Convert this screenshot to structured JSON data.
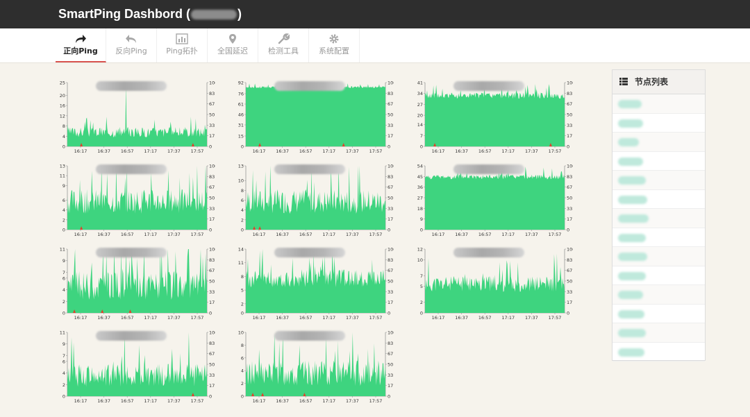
{
  "header": {
    "title_prefix": "SmartPing Dashbord (",
    "title_suffix": ")"
  },
  "nav": {
    "tabs": [
      {
        "label": "正向Ping",
        "icon": "forward-arrow-icon",
        "active": true
      },
      {
        "label": "反向Ping",
        "icon": "reply-arrow-icon",
        "active": false
      },
      {
        "label": "Ping拓扑",
        "icon": "bar-chart-icon",
        "active": false
      },
      {
        "label": "全国延迟",
        "icon": "map-marker-icon",
        "active": false
      },
      {
        "label": "检测工具",
        "icon": "wrench-icon",
        "active": false
      },
      {
        "label": "系统配置",
        "icon": "gear-icon",
        "active": false
      }
    ]
  },
  "sidebar": {
    "title": "节点列表",
    "icon": "list-icon",
    "node_count": 14
  },
  "colors": {
    "fill": "#3ed47f",
    "loss": "#e0412b",
    "header_bg": "#2e2e2e"
  },
  "chart_data": [
    {
      "type": "area",
      "x_ticks": [
        "16:17",
        "16:37",
        "16:57",
        "17:17",
        "17:37",
        "17:57"
      ],
      "y_left": [
        0,
        4,
        8,
        12,
        16,
        20,
        25
      ],
      "y_right": [
        0,
        17,
        33,
        50,
        67,
        83,
        100
      ],
      "latency_level": 5,
      "latency_var": 2,
      "spikes": [
        {
          "at": 0.42,
          "value": 24
        }
      ],
      "loss_markers": [
        0.1,
        0.9
      ]
    },
    {
      "type": "area",
      "x_ticks": [
        "16:17",
        "16:37",
        "16:57",
        "17:17",
        "17:37",
        "17:57"
      ],
      "y_left": [
        0,
        15,
        31,
        46,
        61,
        76,
        92
      ],
      "y_right": [
        0,
        17,
        33,
        50,
        67,
        83,
        100
      ],
      "latency_level": 85,
      "latency_var": 1.5,
      "spikes": [],
      "loss_markers": [
        0.1,
        0.7
      ]
    },
    {
      "type": "area",
      "x_ticks": [
        "16:17",
        "16:37",
        "16:57",
        "17:17",
        "17:37",
        "17:57"
      ],
      "y_left": [
        0,
        7,
        14,
        20,
        27,
        34,
        41
      ],
      "y_right": [
        0,
        17,
        33,
        50,
        67,
        83,
        100
      ],
      "latency_level": 32,
      "latency_var": 2,
      "spikes": [],
      "loss_markers": [
        0.07,
        0.9
      ]
    },
    {
      "type": "area",
      "x_ticks": [
        "16:17",
        "16:37",
        "16:57",
        "17:17",
        "17:37",
        "17:57"
      ],
      "y_left": [
        0,
        2,
        4,
        6,
        9,
        11,
        13
      ],
      "y_right": [
        0,
        17,
        33,
        50,
        67,
        83,
        100
      ],
      "latency_level": 5,
      "latency_var": 2.5,
      "spikes": [],
      "loss_markers": [
        0.1
      ]
    },
    {
      "type": "area",
      "x_ticks": [
        "16:17",
        "16:37",
        "16:57",
        "17:17",
        "17:37",
        "17:57"
      ],
      "y_left": [
        0,
        2,
        4,
        6,
        8,
        10,
        13
      ],
      "y_right": [
        0,
        17,
        33,
        50,
        67,
        83,
        100
      ],
      "latency_level": 5,
      "latency_var": 2.5,
      "spikes": [],
      "loss_markers": [
        0.06,
        0.1
      ]
    },
    {
      "type": "area",
      "x_ticks": [
        "16:17",
        "16:37",
        "16:57",
        "17:17",
        "17:37",
        "17:57"
      ],
      "y_left": [
        0,
        9,
        18,
        27,
        36,
        45,
        54
      ],
      "y_right": [
        0,
        17,
        33,
        50,
        67,
        83,
        100
      ],
      "latency_level": 44,
      "latency_var": 2,
      "spikes": [],
      "loss_markers": []
    },
    {
      "type": "area",
      "x_ticks": [
        "16:17",
        "16:37",
        "16:57",
        "17:17",
        "17:37",
        "17:57"
      ],
      "y_left": [
        0,
        2,
        4,
        6,
        7,
        9,
        11
      ],
      "y_right": [
        0,
        17,
        33,
        50,
        67,
        83,
        100
      ],
      "latency_level": 4,
      "latency_var": 2.5,
      "spikes": [],
      "loss_markers": [
        0.05,
        0.25,
        0.45
      ]
    },
    {
      "type": "area",
      "x_ticks": [
        "16:17",
        "16:37",
        "16:57",
        "17:17",
        "17:37",
        "17:57"
      ],
      "y_left": [
        0,
        2,
        5,
        8,
        11,
        14
      ],
      "y_right": [
        0,
        17,
        33,
        50,
        67,
        83,
        100
      ],
      "latency_level": 7,
      "latency_var": 2,
      "spikes": [],
      "loss_markers": []
    },
    {
      "type": "area",
      "x_ticks": [
        "16:17",
        "16:37",
        "16:57",
        "17:17",
        "17:37",
        "17:57"
      ],
      "y_left": [
        0,
        2,
        5,
        7,
        10,
        12
      ],
      "y_right": [
        0,
        17,
        33,
        50,
        67,
        83,
        100
      ],
      "latency_level": 5,
      "latency_var": 1.5,
      "spikes": [],
      "loss_markers": []
    },
    {
      "type": "area",
      "x_ticks": [
        "16:17",
        "16:37",
        "16:57",
        "17:17",
        "17:37",
        "17:57"
      ],
      "y_left": [
        0,
        2,
        4,
        6,
        7,
        9,
        11
      ],
      "y_right": [
        0,
        17,
        33,
        50,
        67,
        83,
        100
      ],
      "latency_level": 3,
      "latency_var": 2,
      "spikes": [],
      "loss_markers": [
        0.9
      ]
    },
    {
      "type": "area",
      "x_ticks": [
        "16:17",
        "16:37",
        "16:57",
        "17:17",
        "17:37",
        "17:57"
      ],
      "y_left": [
        0,
        2,
        4,
        6,
        8,
        10
      ],
      "y_right": [
        0,
        17,
        33,
        50,
        67,
        83,
        100
      ],
      "latency_level": 3,
      "latency_var": 2,
      "spikes": [],
      "loss_markers": [
        0.05,
        0.12,
        0.42
      ]
    }
  ]
}
